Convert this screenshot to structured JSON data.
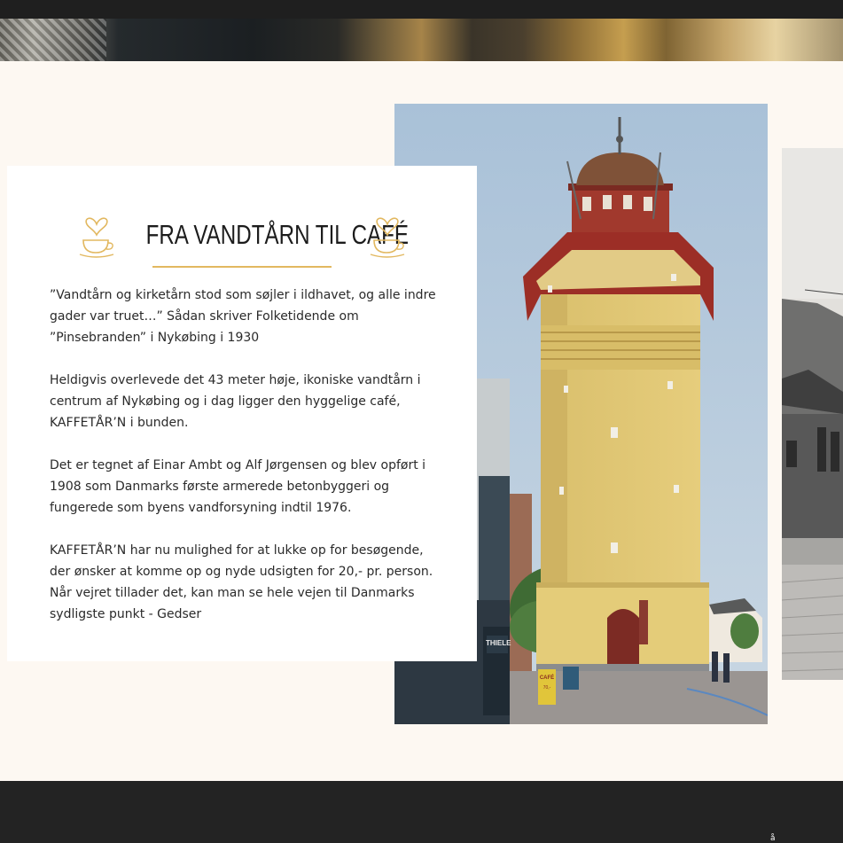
{
  "section": {
    "title": "FRA VANDTÅRN TIL CAFÉ",
    "paragraphs": [
      "”Vandtårn og kirketårn stod som søjler i ildhavet, og alle indre\ngader var truet…” Sådan skriver Folketidende om\n”Pinsebranden” i Nykøbing i 1930",
      "Heldigvis overlevede det 43 meter høje, ikoniske vandtårn i\ncentrum af Nykøbing og i dag ligger den hyggelige café,\nKAFFETÅR’N i bunden.",
      "Det er tegnet af Einar Ambt og Alf Jørgensen og blev opført i\n1908 som Danmarks første armerede betonbyggeri og\nfungerede som byens vandforsyning indtil 1976.",
      "KAFFETÅR’N har nu mulighed for at lukke op for besøgende,\nder ønsker at komme op og nyde udsigten for 20,- pr. person.\nNår vejret tillader det, kan man se hele vejen til Danmarks\nsydligste punkt - Gedser"
    ],
    "icons": {
      "left": "coffee-cup-heart-icon",
      "right": "coffee-cup-heart-icon"
    }
  },
  "photos": {
    "main_sign": "THIELE",
    "main_board": "CAFÉ",
    "main_board_small": "70,-"
  },
  "footer": {
    "mark": "å"
  },
  "colors": {
    "background": "#fdf8f2",
    "accent": "#e2b860",
    "footer": "#232323",
    "card": "#ffffff",
    "text": "#2a2a2a"
  }
}
